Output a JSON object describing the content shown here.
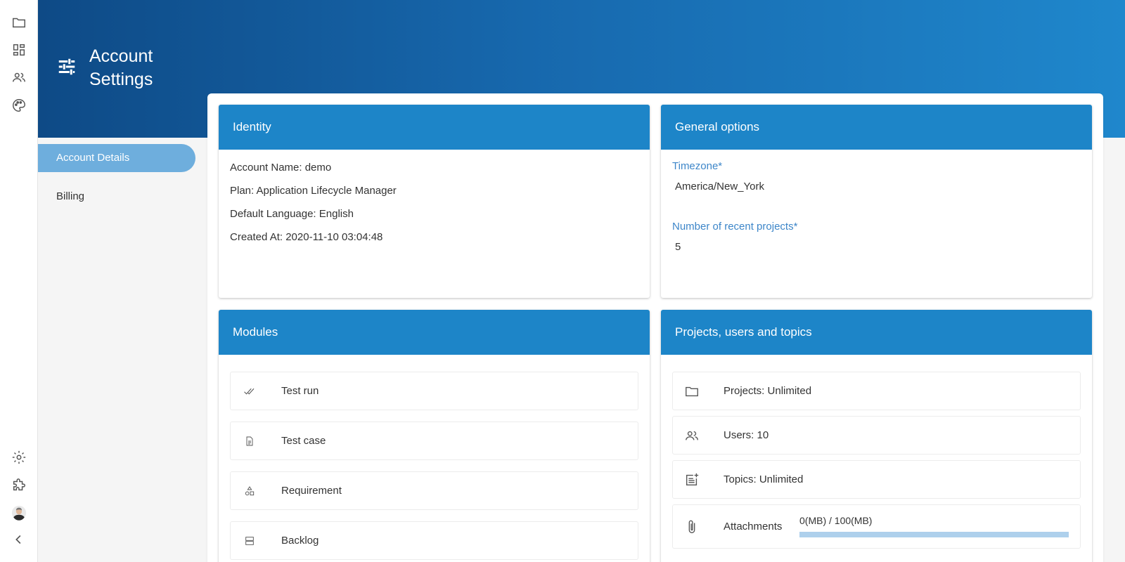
{
  "rail": {
    "top_icons": [
      "folder-icon",
      "dashboard-icon",
      "people-icon",
      "palette-icon"
    ],
    "bottom_icons": [
      "gear-icon",
      "puzzle-icon",
      "avatar",
      "chevron-left-icon"
    ]
  },
  "header": {
    "title": "Account Settings"
  },
  "side_nav": {
    "items": [
      {
        "label": "Account Details",
        "active": true
      },
      {
        "label": "Billing",
        "active": false
      }
    ]
  },
  "identity": {
    "title": "Identity",
    "lines": [
      "Account Name: demo",
      "Plan: Application Lifecycle Manager",
      "Default Language: English",
      "Created At: 2020-11-10 03:04:48"
    ]
  },
  "general_options": {
    "title": "General options",
    "timezone_label": "Timezone*",
    "timezone_value": "America/New_York",
    "recent_label": "Number of recent projects*",
    "recent_value": "5"
  },
  "modules": {
    "title": "Modules",
    "items": [
      {
        "label": "Test run",
        "icon": "double-check-icon"
      },
      {
        "label": "Test case",
        "icon": "document-icon"
      },
      {
        "label": "Requirement",
        "icon": "shapes-icon"
      },
      {
        "label": "Backlog",
        "icon": "storage-icon"
      }
    ]
  },
  "quotas": {
    "title": "Projects, users and topics",
    "items": [
      {
        "label": "Projects: Unlimited",
        "icon": "folder-icon"
      },
      {
        "label": "Users: 10",
        "icon": "people-icon"
      },
      {
        "label": "Topics: Unlimited",
        "icon": "post-add-icon"
      }
    ],
    "attachments": {
      "label": "Attachments",
      "usage_text": "0(MB) / 100(MB)",
      "used_fraction": 0.0,
      "icon": "paperclip-icon"
    }
  },
  "colors": {
    "header_gradient_start": "#0e4a86",
    "header_gradient_end": "#1f87cc",
    "card_header": "#1d85c8",
    "nav_active": "#6eaedd",
    "field_label": "#3d86c9",
    "progress_track": "#aed0ec"
  }
}
